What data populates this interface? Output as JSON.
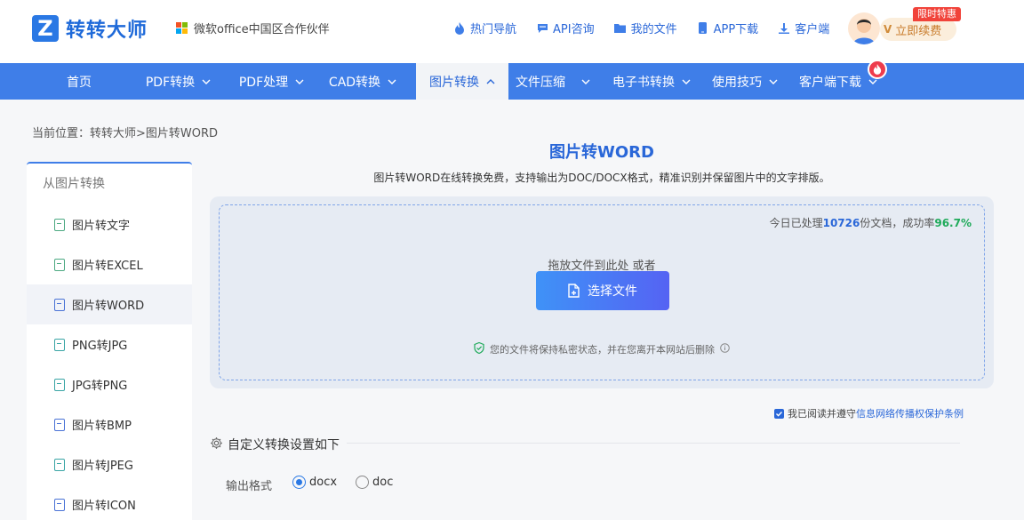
{
  "header": {
    "logo_text": "转转大师",
    "partner_text": "微软office中国区合作伙伴",
    "links": [
      {
        "label": "热门导航",
        "icon": "fire-icon"
      },
      {
        "label": "API咨询",
        "icon": "chat-icon"
      },
      {
        "label": "我的文件",
        "icon": "folder-icon"
      },
      {
        "label": "APP下载",
        "icon": "phone-icon"
      },
      {
        "label": "客户端",
        "icon": "download-icon"
      }
    ],
    "promo_badge": "限时特惠",
    "renew_label": "立即续费"
  },
  "nav": {
    "items": [
      {
        "label": "首页",
        "has_dropdown": false
      },
      {
        "label": "PDF转换",
        "has_dropdown": true
      },
      {
        "label": "PDF处理",
        "has_dropdown": true
      },
      {
        "label": "CAD转换",
        "has_dropdown": true
      },
      {
        "label": "图片转换",
        "has_dropdown": true,
        "active": true
      },
      {
        "label": "文件压缩",
        "has_dropdown": true
      },
      {
        "label": "电子书转换",
        "has_dropdown": true
      },
      {
        "label": "使用技巧",
        "has_dropdown": true
      },
      {
        "label": "客户端下载",
        "has_dropdown": true
      }
    ]
  },
  "breadcrumb": "当前位置：转转大师>图片转WORD",
  "sidebar": {
    "title": "从图片转换",
    "items": [
      {
        "label": "图片转文字"
      },
      {
        "label": "图片转EXCEL"
      },
      {
        "label": "图片转WORD",
        "active": true
      },
      {
        "label": "PNG转JPG"
      },
      {
        "label": "JPG转PNG"
      },
      {
        "label": "图片转BMP"
      },
      {
        "label": "图片转JPEG"
      },
      {
        "label": "图片转ICON"
      }
    ]
  },
  "main": {
    "title": "图片转WORD",
    "description": "图片转WORD在线转换免费，支持输出为DOC/DOCX格式，精准识别并保留图片中的文字排版。",
    "stats": {
      "prefix": "今日已处理",
      "count": "10726",
      "middle": "份文档，成功率",
      "rate": "96.7%"
    },
    "drop_text": "拖放文件到此处 或者",
    "choose_button": "选择文件",
    "privacy_text": "您的文件将保持私密状态，并在您离开本网站后删除",
    "agree_prefix": "我已阅读并遵守",
    "agree_link": "信息网络传播权保护条例",
    "settings_title": "自定义转换设置如下",
    "format_label": "输出格式",
    "format_options": [
      {
        "label": "docx",
        "selected": true
      },
      {
        "label": "doc",
        "selected": false
      }
    ]
  },
  "colors": {
    "brand": "#3f7ee8",
    "accent_link": "#2a67d8",
    "success": "#1faa5a",
    "promo": "#f1433a"
  }
}
